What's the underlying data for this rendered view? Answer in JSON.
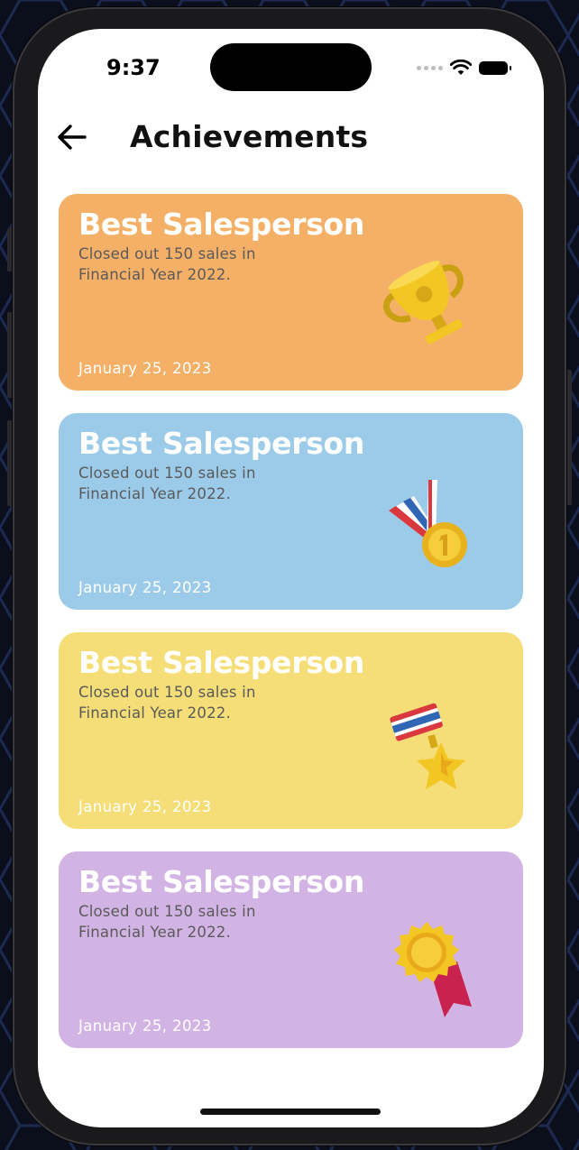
{
  "status_bar": {
    "time": "9:37"
  },
  "header": {
    "title": "Achievements",
    "back_icon": "arrow-left-icon"
  },
  "cards": [
    {
      "title": "Best Salesperson",
      "description": "Closed out 150 sales in Financial Year 2022.",
      "date": "January 25, 2023",
      "icon": "trophy-icon",
      "color": "#F5B068"
    },
    {
      "title": "Best Salesperson",
      "description": "Closed out 150 sales in Financial Year 2022.",
      "date": "January 25, 2023",
      "icon": "gold-medal-icon",
      "color": "#9CCBEA"
    },
    {
      "title": "Best Salesperson",
      "description": "Closed out 150 sales in Financial Year 2022.",
      "date": "January 25, 2023",
      "icon": "star-medal-icon",
      "color": "#F5DE77"
    },
    {
      "title": "Best Salesperson",
      "description": "Closed out 150 sales in Financial Year 2022.",
      "date": "January 25, 2023",
      "icon": "rosette-award-icon",
      "color": "#D2B4E4"
    }
  ]
}
